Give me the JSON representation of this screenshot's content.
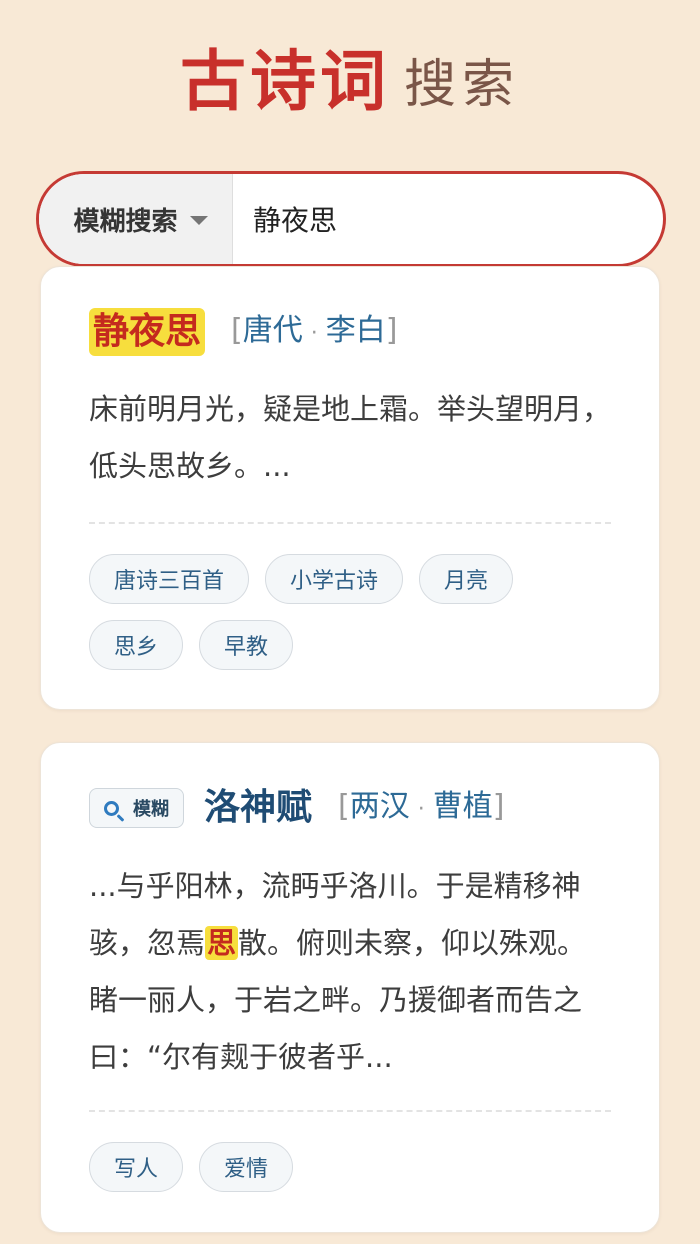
{
  "header": {
    "title": "古诗词",
    "subtitle": "搜索"
  },
  "search": {
    "mode_label": "模糊搜索",
    "query": "静夜思"
  },
  "results": [
    {
      "title": "静夜思",
      "dynasty": "唐代",
      "author": "李白",
      "excerpt": "床前明月光，疑是地上霜。举头望明月，低头思故乡。...",
      "tags": [
        "唐诗三百首",
        "小学古诗",
        "月亮",
        "思乡",
        "早教"
      ]
    },
    {
      "badge": "模糊",
      "title": "洛神赋",
      "dynasty": "两汉",
      "author": "曹植",
      "excerpt_before": "...与乎阳林，流眄乎洛川。于是精移神骇，忽焉",
      "excerpt_highlight": "思",
      "excerpt_after": "散。俯则未察，仰以殊观。睹一丽人，于岩之畔。乃援御者而告之曰：“尔有觌于彼者乎...",
      "tags": [
        "写人",
        "爱情"
      ]
    }
  ],
  "colors": {
    "background": "#f8e9d6",
    "brand_red": "#c8302b",
    "highlight_yellow": "#f7de3d",
    "link_blue": "#2d6a96"
  },
  "icons": {
    "fuzzy_badge": "search-icon",
    "mode_select": "caret-down-icon"
  }
}
